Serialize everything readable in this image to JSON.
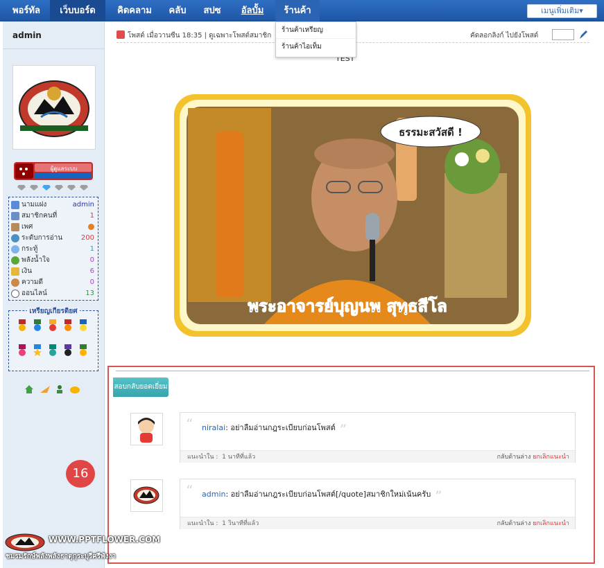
{
  "nav": {
    "items": [
      "พอร์ทัล",
      "เว็บบอร์ด",
      "คิดคลาม",
      "คลับ",
      "สปซ",
      "อัลบั้ม",
      "ร้านค้า"
    ],
    "more_button": "เมนูเพิ่มเติม▾",
    "dropdown": [
      "ร้านค้าเหรียญ",
      "ร้านค้าไอเท็ม"
    ]
  },
  "sidebar": {
    "username": "admin",
    "rank_badge": "ผู้ดูแลระบบ",
    "stats": [
      {
        "label": "นามแฝง",
        "value": "admin",
        "color": "#2233bb",
        "icon": "user-card-icon"
      },
      {
        "label": "สมาชิกคนที่",
        "value": "1",
        "color": "#d43c3c",
        "icon": "member-icon"
      },
      {
        "label": "เพศ",
        "value": "",
        "color": "#333333",
        "icon": "gender-icon"
      },
      {
        "label": "ระดับการอ่าน",
        "value": "200",
        "color": "#d43c3c",
        "icon": "read-level-icon"
      },
      {
        "label": "กระทู้",
        "value": "1",
        "color": "#19a0c8",
        "icon": "thread-icon"
      },
      {
        "label": "พลังน้ำใจ",
        "value": "0",
        "color": "#b040c8",
        "icon": "kindness-icon"
      },
      {
        "label": "เงิน",
        "value": "6",
        "color": "#b040c8",
        "icon": "money-icon"
      },
      {
        "label": "ความดี",
        "value": "0",
        "color": "#b040c8",
        "icon": "goodness-icon"
      },
      {
        "label": "ออนไลน์",
        "value": "13",
        "color": "#2a9a44",
        "icon": "online-icon"
      }
    ],
    "medals_title": "เหรียญเกียรติยศ"
  },
  "post": {
    "header_left": "โพสต์ เมื่อวานซืน 18:35  |  ดูเฉพาะโพสต์สมาชิก",
    "header_right": "คัดลอกลิงก์   ไปยังโพสต์",
    "body_text": "TEST",
    "image_caption": "พระอาจารย์บุญนพ สุทฺธสีโล",
    "speech_bubble": "ธรรมะสวัสดี !"
  },
  "recommend": {
    "tab_label": "สอบกลับยอดเยี่ยม",
    "comments": [
      {
        "author": "niralai",
        "text": ": อย่าลืมอ่านกฎระเบียบก่อนโพสต์",
        "time_label": "แนะนำใน :",
        "time": "1 นาทีที่แล้ว",
        "back": "กลับด้านล่าง",
        "cancel": "ยกเลิกแนะนำ"
      },
      {
        "author": "admin",
        "text": ": อย่าลืมอ่านกฎระเบียบก่อนโพสต์[/quote]สมาชิกใหม่เน้นครับ",
        "time_label": "แนะนำใน :",
        "time": "1 วินาทีที่แล้ว",
        "back": "กลับด้านล่าง",
        "cancel": "ยกเลิกแนะนำ"
      }
    ]
  },
  "annotation_number": "16",
  "watermark": {
    "url": "WWW.PPTFLOWER.COM",
    "text": "ชมรมรักษ์พลังพลังธาตุกุระบุรีศรีพังงา"
  },
  "colors": {
    "nav_bg": "#1e56a5",
    "sidebar_bg": "#e4ecf5",
    "accent_teal": "#36a4ab",
    "highlight_red": "#d9534f",
    "link_blue": "#2a64b3"
  }
}
